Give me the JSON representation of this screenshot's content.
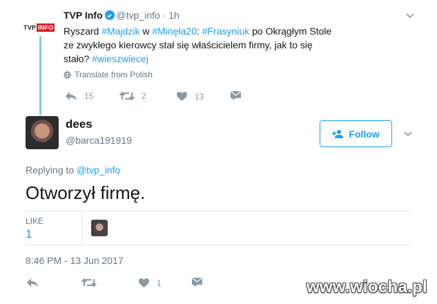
{
  "parent": {
    "logo": {
      "part1": "TVP",
      "part2": "INFO"
    },
    "name": "TVP Info",
    "handle_time": "@tvp_info · 1h",
    "text_parts": [
      {
        "t": "Ryszard ",
        "tag": false
      },
      {
        "t": "#Majdzik",
        "tag": true
      },
      {
        "t": " w ",
        "tag": false
      },
      {
        "t": "#Minęła20",
        "tag": true
      },
      {
        "t": ": ",
        "tag": false
      },
      {
        "t": "#Frasyniuk",
        "tag": true
      },
      {
        "t": " po Okrągłym Stole ze zwykłego kierowcy stał się właścicielem firmy, jak to się stało? ",
        "tag": false
      },
      {
        "t": "#wieszwiecej",
        "tag": true
      }
    ],
    "translate_label": "Translate from Polish",
    "actions": {
      "reply_count": "15",
      "retweet_count": "2",
      "like_count": "13"
    }
  },
  "reply": {
    "name": "dees",
    "handle": "@barca191919",
    "follow_label": "Follow",
    "replying_prefix": "Replying to ",
    "replying_to": "@tvp_info",
    "text": "Otworzył firmę.",
    "likes_label": "LIKE",
    "likes_count": "1",
    "timestamp": "8:46 PM - 13 Jun 2017",
    "actions": {
      "like_count": "1"
    }
  },
  "watermark": "www.wiocha.pl",
  "colors": {
    "accent": "#1da1f2",
    "muted": "#657786",
    "icon": "#8899a6"
  }
}
